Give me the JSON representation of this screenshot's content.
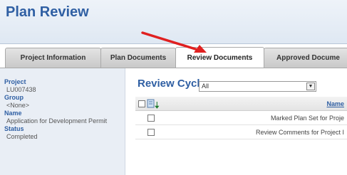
{
  "header": {
    "title": "Plan Review"
  },
  "tabs": [
    {
      "label": "Project Information",
      "active": false
    },
    {
      "label": "Plan Documents",
      "active": false
    },
    {
      "label": "Review Documents",
      "active": true
    },
    {
      "label": "Approved Docume",
      "active": false
    }
  ],
  "sidebar": {
    "project_label": "Project",
    "project_value": "LU007438",
    "group_label": "Group",
    "group_value": "<None>",
    "name_label": "Name",
    "name_value": "Application for Development Permit",
    "status_label": "Status",
    "status_value": "Completed"
  },
  "review": {
    "title": "Review Cycle",
    "cycle_selected": "All",
    "name_header": "Name",
    "rows": [
      {
        "name": "Marked Plan Set for Proje"
      },
      {
        "name": "Review Comments for Project I"
      }
    ]
  },
  "colors": {
    "accent": "#2f5fa3",
    "arrow": "#e02020",
    "sidebar_bg": "#e9eef5"
  },
  "icons": {
    "sort": "green-down-arrow",
    "document": "document-icon",
    "dropdown": "chevron-down-icon"
  }
}
